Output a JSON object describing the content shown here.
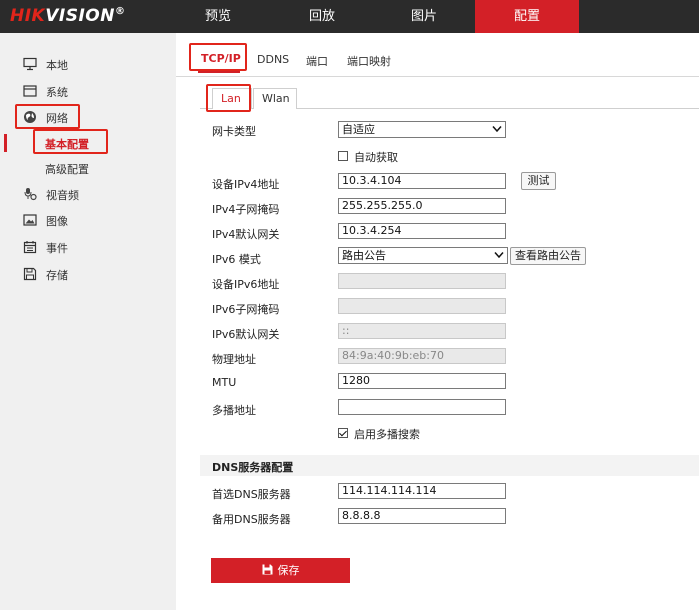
{
  "app": {
    "logo_brand": "HIK",
    "logo_rest": "VISION",
    "logo_reg": "®"
  },
  "nav": {
    "items": [
      {
        "label": "预览"
      },
      {
        "label": "回放"
      },
      {
        "label": "图片"
      },
      {
        "label": "配置"
      }
    ],
    "active": "配置"
  },
  "sidebar": {
    "items": [
      {
        "label": "本地",
        "icon": "monitor-icon"
      },
      {
        "label": "系统",
        "icon": "window-icon"
      },
      {
        "label": "网络",
        "icon": "globe-icon"
      },
      {
        "label": "视音频",
        "icon": "microphone-camera-icon"
      },
      {
        "label": "图像",
        "icon": "image-icon"
      },
      {
        "label": "事件",
        "icon": "calendar-icon"
      },
      {
        "label": "存储",
        "icon": "save-icon"
      }
    ],
    "network_sub": [
      {
        "label": "基本配置",
        "active": true
      },
      {
        "label": "高级配置",
        "active": false
      }
    ]
  },
  "tabs": {
    "items": [
      "TCP/IP",
      "DDNS",
      "端口",
      "端口映射"
    ],
    "active": "TCP/IP"
  },
  "subtabs": {
    "items": [
      "Lan",
      "Wlan"
    ],
    "active": "Lan"
  },
  "form": {
    "nic_type": {
      "label": "网卡类型",
      "value": "自适应"
    },
    "dhcp": {
      "label": "自动获取",
      "checked": false
    },
    "ipv4_addr": {
      "label": "设备IPv4地址",
      "value": "10.3.4.104"
    },
    "test_button": "测试",
    "ipv4_mask": {
      "label": "IPv4子网掩码",
      "value": "255.255.255.0"
    },
    "ipv4_gw": {
      "label": "IPv4默认网关",
      "value": "10.3.4.254"
    },
    "ipv6_mode": {
      "label": "IPv6 模式",
      "value": "路由公告"
    },
    "view_route_button": "查看路由公告",
    "ipv6_addr": {
      "label": "设备IPv6地址",
      "value": ""
    },
    "ipv6_mask": {
      "label": "IPv6子网掩码",
      "value": ""
    },
    "ipv6_gw": {
      "label": "IPv6默认网关",
      "value": "::"
    },
    "mac": {
      "label": "物理地址",
      "value": "84:9a:40:9b:eb:70"
    },
    "mtu": {
      "label": "MTU",
      "value": "1280"
    },
    "multicast": {
      "label": "多播地址",
      "value": ""
    },
    "multicast_search": {
      "label": "启用多播搜索",
      "checked": true
    }
  },
  "dns": {
    "section_title": "DNS服务器配置",
    "primary": {
      "label": "首选DNS服务器",
      "value": "114.114.114.114"
    },
    "secondary": {
      "label": "备用DNS服务器",
      "value": "8.8.8.8"
    }
  },
  "save_button": "保存",
  "colors": {
    "accent": "#d32027",
    "topbar": "#2b2b2b",
    "sidebar": "#f0f0f0",
    "highlight_box": "#e1251b"
  }
}
